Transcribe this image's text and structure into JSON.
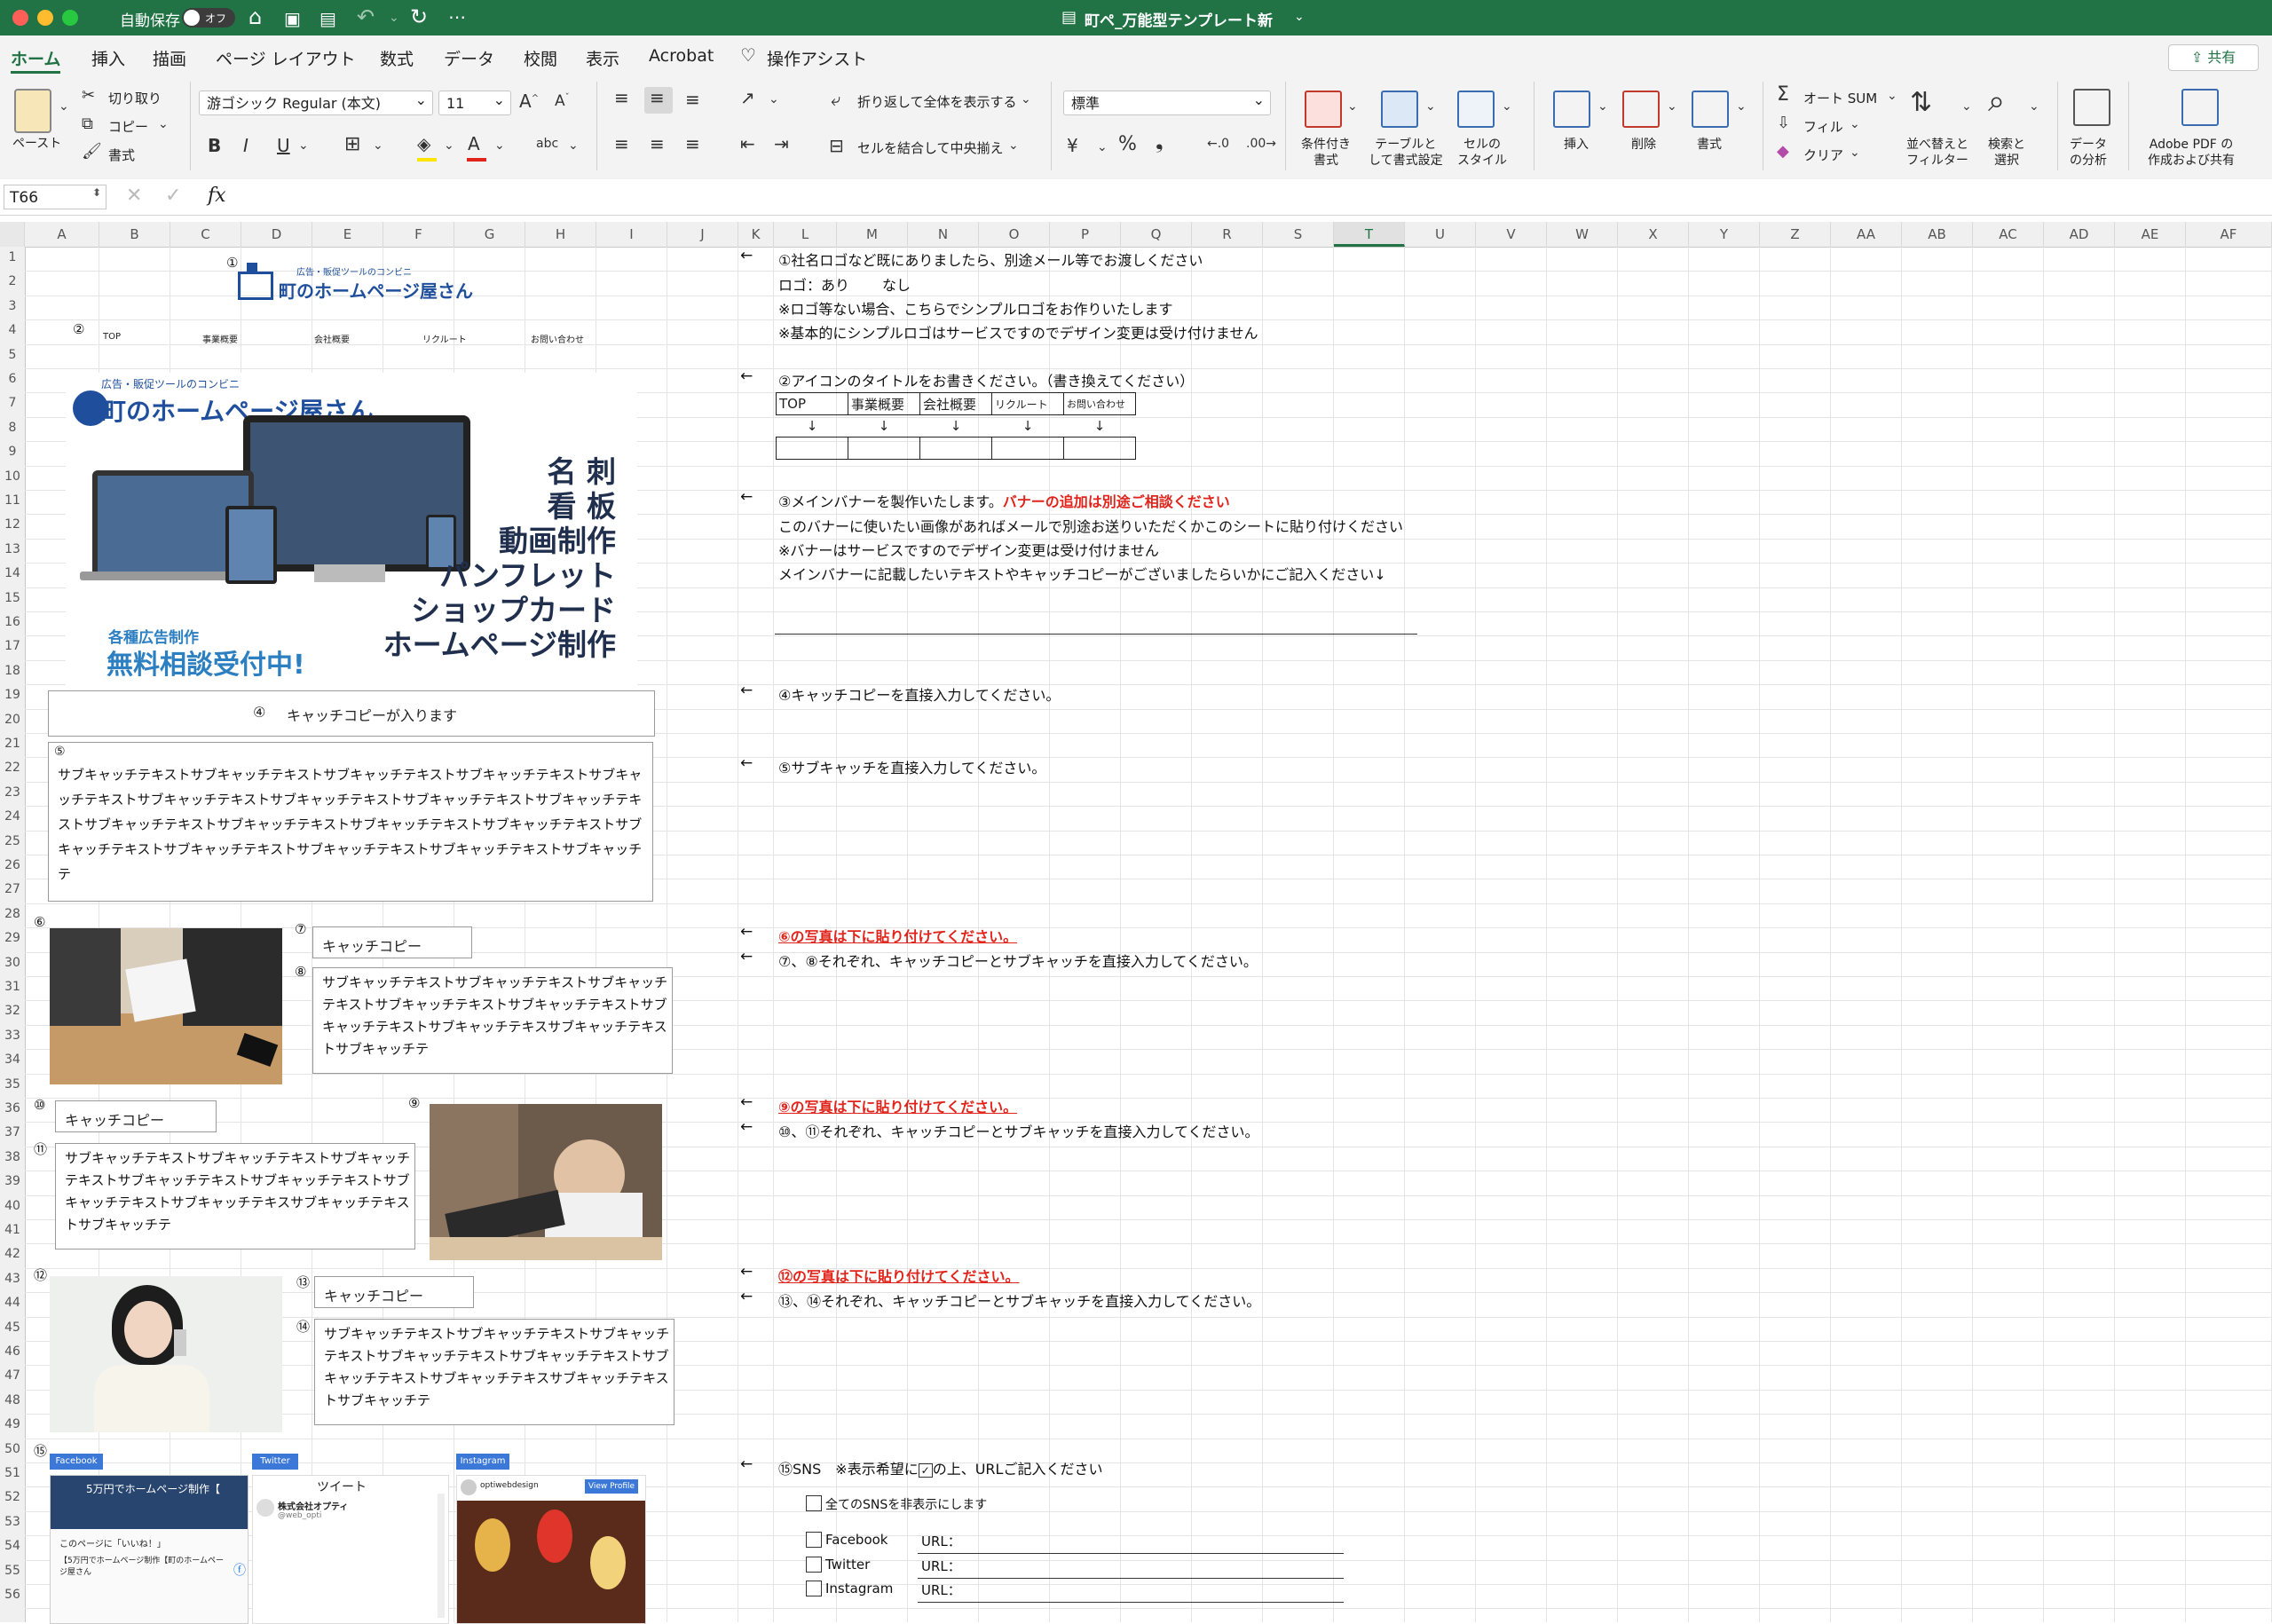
{
  "window": {
    "autosave_label": "自動保存",
    "autosave_state": "オフ",
    "title": "町ペ_万能型テンプレート新"
  },
  "menu": {
    "tabs": [
      "ホーム",
      "挿入",
      "描画",
      "ページ レイアウト",
      "数式",
      "データ",
      "校閲",
      "表示",
      "Acrobat",
      "操作アシスト"
    ],
    "share": "共有"
  },
  "ribbon": {
    "paste": "ペースト",
    "cut": "切り取り",
    "copy": "コピー",
    "format_painter": "書式",
    "font_name": "游ゴシック Regular (本文)",
    "font_size": "11",
    "wrap_text": "折り返して全体を表示する",
    "merge_center": "セルを結合して中央揃え",
    "number_format": "標準",
    "conditional_format": [
      "条件付き",
      "書式"
    ],
    "format_as_table": [
      "テーブルと",
      "して書式設定"
    ],
    "cell_styles": [
      "セルの",
      "スタイル"
    ],
    "insert": "挿入",
    "delete": "削除",
    "format": "書式",
    "autosum": "オート SUM",
    "fill": "フィル",
    "clear": "クリア",
    "sort_filter": [
      "並べ替えと",
      "フィルター"
    ],
    "find_select": [
      "検索と",
      "選択"
    ],
    "analyze": [
      "データ",
      "の分析"
    ],
    "adobe": [
      "Adobe PDF の",
      "作成および共有"
    ]
  },
  "formula_bar": {
    "name_box": "T66",
    "fx": "fx",
    "content": ""
  },
  "columns": [
    "A",
    "B",
    "C",
    "D",
    "E",
    "F",
    "G",
    "H",
    "I",
    "J",
    "K",
    "L",
    "M",
    "N",
    "O",
    "P",
    "Q",
    "R",
    "S",
    "T",
    "U",
    "V",
    "W",
    "X",
    "Y",
    "Z",
    "AA",
    "AB",
    "AC",
    "AD",
    "AE",
    "AF"
  ],
  "selected_column": "T",
  "rows": [
    "1",
    "2",
    "3",
    "4",
    "5",
    "6",
    "7",
    "8",
    "9",
    "10",
    "11",
    "12",
    "13",
    "14",
    "15",
    "16",
    "17",
    "18",
    "19",
    "20",
    "21",
    "22",
    "23",
    "24",
    "25",
    "26",
    "27",
    "28",
    "29",
    "30",
    "31",
    "32",
    "33",
    "34",
    "35",
    "36",
    "37",
    "38",
    "39",
    "40",
    "41",
    "42",
    "43",
    "44",
    "45",
    "46",
    "47",
    "48",
    "49",
    "50",
    "51",
    "52",
    "53",
    "54",
    "55",
    "56"
  ],
  "mockup": {
    "marks": [
      "①",
      "②",
      "③",
      "④",
      "⑤",
      "⑥",
      "⑦",
      "⑧",
      "⑨",
      "⑩",
      "⑪",
      "⑫",
      "⑬",
      "⑭",
      "⑮"
    ],
    "logo_tagline": "広告・販促ツールのコンビニ",
    "logo_text": "町のホームページ屋さん",
    "nav": [
      "TOP",
      "事業概要",
      "会社概要",
      "リクルート",
      "お問い合わせ"
    ],
    "banner_tagline": "広告・販促ツールのコンビニ",
    "banner_logo": "町のホームページ屋さん",
    "banner_lines": [
      "名 刺",
      "看 板",
      "動画制作",
      "パンフレット",
      "ショップカード",
      "ホームページ制作"
    ],
    "banner_badge_top": "各種広告制作",
    "banner_badge_main": "無料相談受付中!",
    "catch_main": "キャッチコピーが入ります",
    "sub_catch_long": "サブキャッチテキストサブキャッチテキストサブキャッチテキストサブキャッチテキストサブキャッチテキストサブキャッチテキストサブキャッチテキストサブキャッチテキストサブキャッチテキストサブキャッチテキストサブキャッチテキストサブキャッチテキストサブキャッチテキストサブキャッチテキストサブキャッチテキストサブキャッチテキストサブキャッチテキストサブキャッチテ",
    "catch_short": "キャッチコピー",
    "sub_catch_short": "サブキャッチテキストサブキャッチテキストサブキャッチテキストサブキャッチテキストサブキャッチテキストサブキャッチテキストサブキャッチテキスサブキャッチテキストサブキャッチテ",
    "sns_labels": [
      "Facebook",
      "Twitter",
      "Instagram"
    ],
    "fb_post_title": "5万円でホームページ制作【",
    "fb_like": "このページに「いいね！」",
    "fb_body": "【5万円でホームページ制作【町のホームページ屋さん",
    "tw_header": "ツイート",
    "tw_account": "株式会社オプティ",
    "tw_handle": "@web_opti",
    "ig_account": "optiwebdesign",
    "ig_button": "View Profile"
  },
  "notes": {
    "n1": "①社名ロゴなど既にありましたら、別途メール等でお渡しください",
    "n1_logo": "ロゴ：あり",
    "n1_none": "なし",
    "n1_sub1": "※ロゴ等ない場合、こちらでシンプルロゴをお作りいたします",
    "n1_sub2": "※基本的にシンプルロゴはサービスですのでデザイン変更は受け付けません",
    "n2": "②アイコンのタイトルをお書きください。（書き換えてください）",
    "n2_table": [
      "TOP",
      "事業概要",
      "会社概要",
      "リクルート",
      "お問い合わせ"
    ],
    "n2_arrow": "↓",
    "n3": "③メインバナーを製作いたします。",
    "n3_red": "バナーの追加は別途ご相談ください",
    "n3_sub1": "このバナーに使いたい画像があればメールで別途お送りいただくかこのシートに貼り付けください",
    "n3_sub2": "※バナーはサービスですのでデザイン変更は受け付けません",
    "n3_sub3": "メインバナーに記載したいテキストやキャッチコピーがございましたらいかにご記入ください↓",
    "n4": "④キャッチコピーを直接入力してください。",
    "n5": "⑤サブキャッチを直接入力してください。",
    "n6": "⑥の写真は下に貼り付けてください。",
    "n7": "⑦、⑧それぞれ、キャッチコピーとサブキャッチを直接入力してください。",
    "n9": "⑨の写真は下に貼り付けてください。",
    "n10": "⑩、⑪それぞれ、キャッチコピーとサブキャッチを直接入力してください。",
    "n12": "⑫の写真は下に貼り付けてください。",
    "n13": "⑬、⑭それぞれ、キャッチコピーとサブキャッチを直接入力してください。",
    "n15": "⑮SNS　※表示希望に",
    "n15_tail": "の上、URLご記入ください",
    "sns_hide": "全てのSNSを非表示にします",
    "sns_fb": "Facebook",
    "sns_tw": "Twitter",
    "sns_ig": "Instagram",
    "url": "URL：",
    "arrow": "←"
  },
  "colors": {
    "excel_green": "#217346",
    "red_note": "#e0241b",
    "banner_blue": "#1f4f9c"
  }
}
